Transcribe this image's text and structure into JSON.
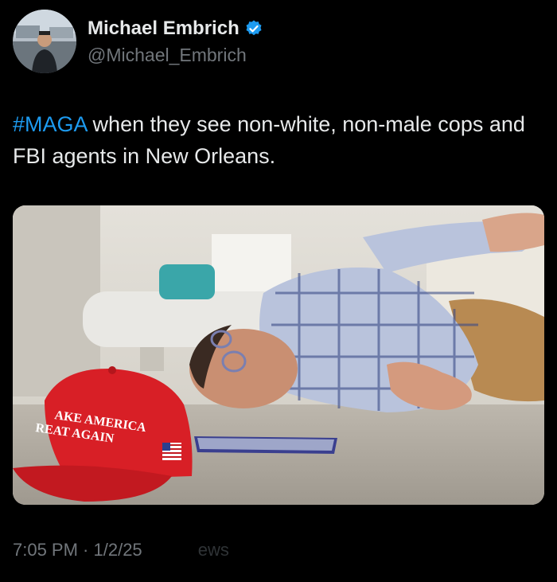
{
  "author": {
    "display_name": "Michael Embrich",
    "handle": "@Michael_Embrich",
    "verified": true
  },
  "tweet": {
    "hashtag": "#MAGA",
    "text_rest": " when they see non-white, non-male cops and FBI agents in New Orleans."
  },
  "media": {
    "hat_line1": "AKE AMERICA",
    "hat_line2": "REAT AGAIN"
  },
  "meta": {
    "time": "7:05 PM",
    "separator": " · ",
    "date": "1/2/25",
    "views_label": "ews"
  },
  "icons": [
    "verified-badge-icon",
    "avatar-image"
  ],
  "colors": {
    "background": "#000000",
    "text": "#e7e9ea",
    "muted": "#71767b",
    "link": "#1d9bf0",
    "hat": "#d81f26"
  }
}
